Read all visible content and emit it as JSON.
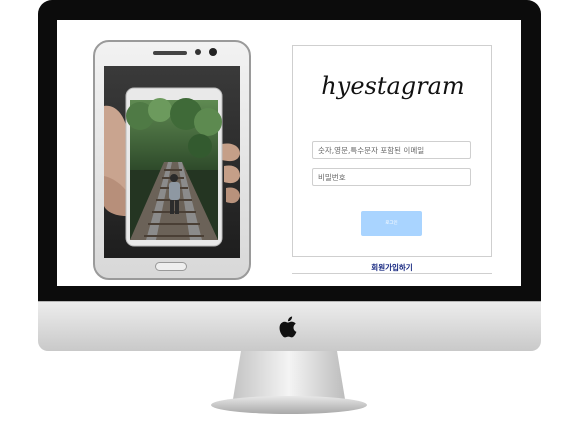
{
  "app": {
    "logo_text": "hyestagram"
  },
  "login": {
    "email_placeholder": "숫자,영문,특수문자 포함된 이메일",
    "password_placeholder": "비밀번호",
    "login_button": "로그인",
    "signup_link": "회원가입하기"
  },
  "colors": {
    "login_button_bg": "#a9d4ff",
    "signup_link": "#12237e",
    "monitor_bezel": "#0c0c0c"
  },
  "icons": {
    "apple_logo": "apple-logo-icon"
  }
}
